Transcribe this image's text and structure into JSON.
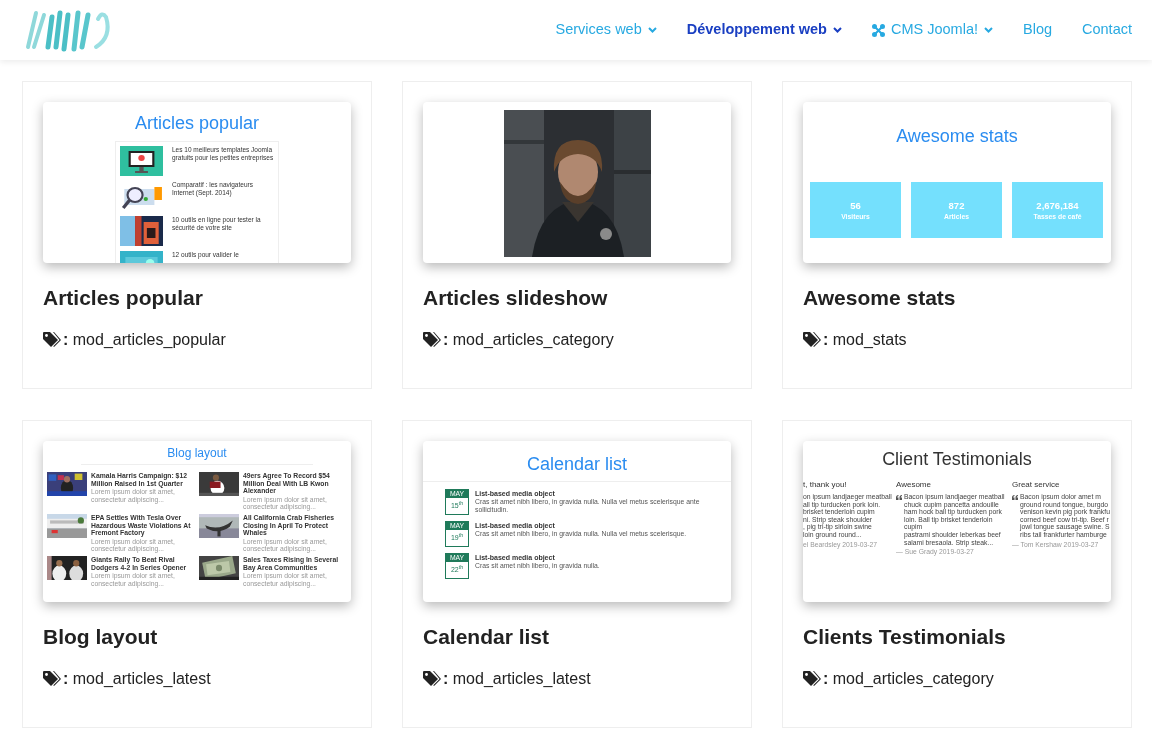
{
  "nav": [
    {
      "label": "Services web",
      "dropdown": true,
      "icon": false,
      "selected": false
    },
    {
      "label": "Développement web",
      "dropdown": true,
      "icon": false,
      "selected": true
    },
    {
      "label": "CMS Joomla!",
      "dropdown": true,
      "icon": true,
      "selected": false
    },
    {
      "label": "Blog",
      "dropdown": false,
      "icon": false,
      "selected": false
    },
    {
      "label": "Contact",
      "dropdown": false,
      "icon": false,
      "selected": false
    }
  ],
  "cards": [
    {
      "title": "Articles popular",
      "tag": "**:** mod_articles_popular",
      "preview": {
        "kind": "popular",
        "heading": "Articles popular",
        "items": [
          "Les 10 meilleurs templates Joomla gratuits pour les petites entreprises",
          "Comparatif : les navigateurs Internet (Sept. 2014)",
          "10 outils en ligne pour tester la sécurité de votre site",
          "12 outils pour valider le"
        ]
      }
    },
    {
      "title": "Articles slideshow",
      "tag": "**:** mod_articles_category",
      "preview": {
        "kind": "slideshow"
      }
    },
    {
      "title": "Awesome stats",
      "tag": "**:** mod_stats",
      "preview": {
        "kind": "stats",
        "heading": "Awesome stats",
        "stats": [
          {
            "value": "56",
            "label": "Visiteurs"
          },
          {
            "value": "872",
            "label": "Articles"
          },
          {
            "value": "2,676,184",
            "label": "Tasses de café"
          }
        ]
      }
    },
    {
      "title": "Blog layout",
      "tag": "**:** mod_articles_latest",
      "preview": {
        "kind": "blog",
        "heading": "Blog layout",
        "posts": [
          {
            "title": "Kamala Harris Campaign: $12 Million Raised In 1st Quarter",
            "excerpt": "Lorem ipsum dolor sit amet, consectetur adipiscing..."
          },
          {
            "title": "49ers Agree To Record $54 Million Deal With LB Kwon Alexander",
            "excerpt": "Lorem ipsum dolor sit amet, consectetur adipiscing..."
          },
          {
            "title": "EPA Settles With Tesla Over Hazardous Waste Violations At Fremont Factory",
            "excerpt": "Lorem ipsum dolor sit amet, consectetur adipiscing..."
          },
          {
            "title": "All California Crab Fisheries Closing In April To Protect Whales",
            "excerpt": "Lorem ipsum dolor sit amet, consectetur adipiscing..."
          },
          {
            "title": "Giants Rally To Beat Rival Dodgers 4-2 In Series Opener",
            "excerpt": "Lorem ipsum dolor sit amet, consectetur adipiscing..."
          },
          {
            "title": "Sales Taxes Rising In Several Bay Area Communities",
            "excerpt": "Lorem ipsum dolor sit amet, consectetur adipiscing..."
          }
        ]
      }
    },
    {
      "title": "Calendar list",
      "tag": "**:** mod_articles_latest",
      "preview": {
        "kind": "calendar",
        "heading": "Calendar list",
        "events": [
          {
            "month": "MAY",
            "day": "15$^{th}$",
            "title": "List-based media object",
            "text": "Cras sit amet nibh libero, in gravida nulla. Nulla vel metus scelerisque ante sollicitudin."
          },
          {
            "month": "MAY",
            "day": "19$^{th}$",
            "title": "List-based media object",
            "text": "Cras sit amet nibh libero, in gravida nulla. Nulla vel metus scelerisque."
          },
          {
            "month": "MAY",
            "day": "22$^{th}$",
            "title": "List-based media object",
            "text": "Cras sit amet nibh libero, in gravida nulla."
          }
        ]
      }
    },
    {
      "title": "Clients Testimonials",
      "tag": "**:** mod_articles_category",
      "preview": {
        "kind": "testimonials",
        "heading": "Client Testimonials",
        "quotes": [
          {
            "title": "t, thank you!",
            "quote_mark": false,
            "lines": [
              "on ipsum landjaeger meatball",
              "all tip turducken pork loin.",
              "brisket tenderloin cupim",
              "ni. Strip steak shoulder",
              ", pig tri-tip sirloin swine",
              "loin ground round..."
            ],
            "author": "el Beardsley 2019-03-27"
          },
          {
            "title": "Awesome",
            "quote_mark": true,
            "lines": [
              "Bacon ipsum landjaeger meatball",
              "chuck cupim pancetta andouille",
              "ham hock ball tip turducken pork",
              "loin. Ball tip brisket tenderloin cupim",
              "pastrami shoulder leberkas beef",
              "salami bresaola. Strip steak..."
            ],
            "author": "— Sue Grady 2019-03-27"
          },
          {
            "title": "Great service",
            "quote_mark": true,
            "lines": [
              "Bacon ipsum dolor amet m",
              "ground round tongue, burgdo",
              "venison kevin pig pork frankfu",
              "corned beef cow tri-tip. Beef r",
              "jowl tongue sausage swine. S",
              "ribs tail frankfurter hamburge"
            ],
            "author": "— Tom Kershaw 2019-03-27"
          }
        ]
      }
    }
  ]
}
